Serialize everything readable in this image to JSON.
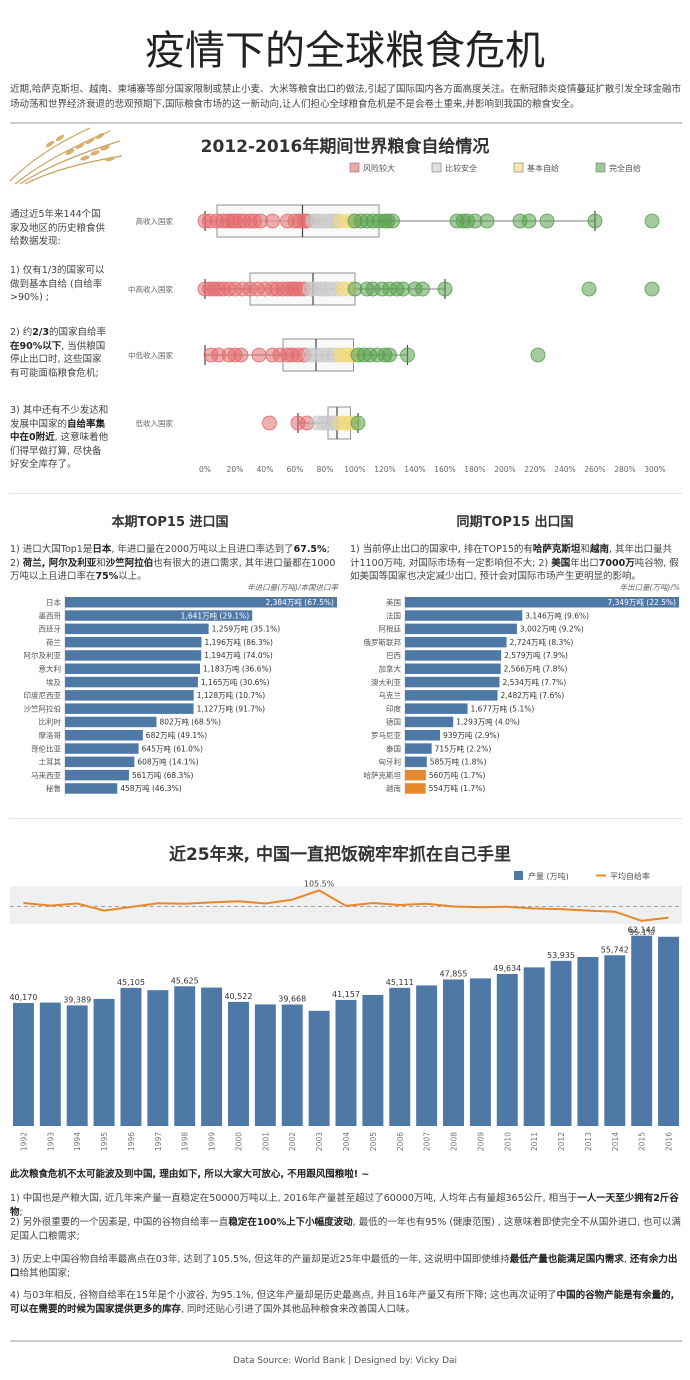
{
  "title": "疫情下的全球粮食危机",
  "intro": "近期,哈萨克斯坦、越南、柬埔寨等部分国家限制或禁止小麦、大米等粮食出口的做法,引起了国际国内各方面高度关注。在新冠肺炎疫情蔓延扩散引发全球金融市场动荡和世界经济衰退的悲观预期下,国际粮食市场的这一新动向,让人们担心全球粮食危机是不是会卷土重来,并影响到我国的粮食安全。",
  "colors": {
    "blue": "#4e79a7",
    "orange": "#e8872b",
    "red": "#e36b6d",
    "gray": "#c9c9c9",
    "yellow": "#f1d97a",
    "green": "#59a14f"
  },
  "self_sufficiency": {
    "title": "2012-2016年期间世界粮食自给情况",
    "legend": [
      "风险较大",
      "比较安全",
      "基本自给",
      "完全自给"
    ],
    "side_intro": "通过近5年来144个国家及地区的历史粮食供给数据发现:",
    "side_p1": "1) 仅有1/3的国家可以做到基本自给 (自给率>90%) ;",
    "side_p2_a": "2) 约",
    "side_p2_b": "2/3",
    "side_p2_c": "的国家自给率",
    "side_p2_d": "在90%以下",
    "side_p2_e": ", 当供粮国停止出口时, 这些国家有可能面临粮食危机;",
    "side_p3_a": "3) 其中还有不少发达和发展中国家的",
    "side_p3_b": "自给率集中在0附近",
    "side_p3_c": ", 这意味着他们得早做打算, 尽快备好安全库存了。",
    "axis_ticks": [
      "0%",
      "20%",
      "40%",
      "60%",
      "80%",
      "100%",
      "120%",
      "140%",
      "160%",
      "180%",
      "200%",
      "220%",
      "240%",
      "260%",
      "280%",
      "300%"
    ],
    "chart_data": {
      "type": "scatter",
      "x_unit": "%",
      "xlim": [
        0,
        300
      ],
      "groups": [
        {
          "name": "高收入国家",
          "box": [
            8,
            65,
            116
          ],
          "whisker": [
            0,
            260
          ],
          "points": [
            0,
            3,
            8,
            12,
            15,
            18,
            20,
            23,
            26,
            30,
            33,
            37,
            45,
            55,
            60,
            63,
            66,
            68,
            72,
            75,
            78,
            82,
            85,
            88,
            90,
            95,
            98,
            100,
            104,
            108,
            112,
            116,
            120,
            122,
            125,
            168,
            172,
            175,
            180,
            188,
            210,
            216,
            228,
            260,
            298
          ]
        },
        {
          "name": "中高收入国家",
          "box": [
            30,
            72,
            100
          ],
          "whisker": [
            0,
            160
          ],
          "points": [
            0,
            3,
            6,
            9,
            12,
            16,
            20,
            25,
            30,
            35,
            40,
            45,
            48,
            52,
            55,
            58,
            60,
            63,
            66,
            70,
            73,
            77,
            80,
            84,
            88,
            92,
            96,
            100,
            108,
            112,
            118,
            123,
            128,
            132,
            140,
            145,
            160,
            256,
            298
          ]
        },
        {
          "name": "中低收入国家",
          "box": [
            52,
            74,
            99
          ],
          "whisker": [
            0,
            135
          ],
          "points": [
            4,
            9,
            16,
            20,
            24,
            36,
            45,
            50,
            55,
            58,
            62,
            66,
            70,
            74,
            78,
            82,
            86,
            90,
            93,
            96,
            99,
            102,
            106,
            110,
            115,
            120,
            123,
            135,
            222
          ]
        },
        {
          "name": "低收入国家",
          "box": [
            82,
            88,
            97
          ],
          "whisker": [
            62,
            102
          ],
          "points": [
            43,
            62,
            68,
            75,
            79,
            82,
            85,
            87,
            90,
            93,
            96,
            99,
            102
          ]
        }
      ]
    }
  },
  "imports": {
    "title": "本期TOP15 进口国",
    "note_1": "1) 进口大国Top1是",
    "note_2": "日本",
    "note_3": ", 年进口量在2000万吨以上且进口率达到了",
    "note_4": "67.5%",
    "note_5": "; 2) ",
    "note_6": "荷兰, 阿尔及利亚",
    "note_7": "和",
    "note_8": "沙竺阿拉伯",
    "note_9": "也有很大的进口需求, 其年进口量都在1000万吨以上且进口率在",
    "note_10": "75%",
    "note_11": "以上。",
    "axis_label": "年进口量(万吨)/本国进口率",
    "chart_data": {
      "type": "bar",
      "categories": [
        "日本",
        "墨西哥",
        "西班牙",
        "荷兰",
        "阿尔及利亚",
        "意大利",
        "埃及",
        "印度尼西亚",
        "沙竺阿拉伯",
        "比利时",
        "摩洛哥",
        "哥伦比亚",
        "土耳其",
        "马来西亚",
        "秘鲁"
      ],
      "values": [
        2384,
        1641,
        1259,
        1196,
        1194,
        1183,
        1165,
        1128,
        1127,
        802,
        682,
        645,
        608,
        561,
        458
      ],
      "labels": [
        "2,384万吨 (67.5%)",
        "1,641万吨 (29.1%)",
        "1,259万吨 (35.1%)",
        "1,196万吨 (86.3%)",
        "1,194万吨 (74.0%)",
        "1,183万吨 (36.6%)",
        "1,165万吨 (30.6%)",
        "1,128万吨 (10.7%)",
        "1,127万吨 (91.7%)",
        "802万吨 (68.5%)",
        "682万吨 (49.1%)",
        "645万吨 (61.0%)",
        "608万吨 (14.1%)",
        "561万吨 (68.3%)",
        "458万吨 (46.3%)"
      ]
    }
  },
  "exports": {
    "title": "同期TOP15 出口国",
    "note_1": "1) 当前停止出口的国家中, 排在TOP15的有",
    "note_2": "哈萨克斯坦",
    "note_3": "和",
    "note_4": "越南",
    "note_5": ", 其年出口量共计1100万吨, 对国际市场有一定影响但不大; 2) ",
    "note_6": "美国",
    "note_7": "年出口",
    "note_8": "7000万",
    "note_9": "吨谷物, 假如美国等国家也决定减少出口, 预计会对国际市场产生更明显的影响。",
    "axis_label": "年出口量(万吨)/%",
    "chart_data": {
      "type": "bar",
      "categories": [
        "美国",
        "法国",
        "阿根廷",
        "俄罗斯联邦",
        "巴西",
        "加拿大",
        "澳大利亚",
        "乌克兰",
        "印度",
        "德国",
        "罗马尼亚",
        "泰国",
        "匈牙利",
        "哈萨克斯坦",
        "越南"
      ],
      "values": [
        7349,
        3146,
        3002,
        2724,
        2579,
        2566,
        2534,
        2482,
        1677,
        1293,
        939,
        715,
        585,
        560,
        554
      ],
      "labels": [
        "7,349万吨 (22.5%)",
        "3,146万吨 (9.6%)",
        "3,002万吨 (9.2%)",
        "2,724万吨 (8.3%)",
        "2,579万吨 (7.9%)",
        "2,566万吨 (7.8%)",
        "2,534万吨 (7.7%)",
        "2,482万吨 (7.6%)",
        "1,677万吨 (5.1%)",
        "1,293万吨 (4.0%)",
        "939万吨 (2.9%)",
        "715万吨 (2.2%)",
        "585万吨 (1.8%)",
        "560万吨 (1.7%)",
        "554万吨 (1.7%)"
      ],
      "highlight": [
        "哈萨克斯坦",
        "越南"
      ]
    }
  },
  "china": {
    "title": "近25年来, 中国一直把饭碗牢牢抓在自己手里",
    "legend_bar": "产量 (万吨)",
    "legend_line": "平均自给率",
    "peak_label": "105.5%",
    "low_label": "95.1%",
    "chart_data": {
      "type": "bar",
      "categories": [
        "1992",
        "1993",
        "1994",
        "1995",
        "1996",
        "1997",
        "1998",
        "1999",
        "2000",
        "2001",
        "2002",
        "2003",
        "2004",
        "2005",
        "2006",
        "2007",
        "2008",
        "2009",
        "2010",
        "2011",
        "2012",
        "2013",
        "2014",
        "2015",
        "2016"
      ],
      "series": [
        {
          "name": "产量 (万吨)",
          "values": [
            40170,
            40300,
            39389,
            41500,
            45105,
            44350,
            45625,
            45200,
            40522,
            39700,
            39668,
            37600,
            41157,
            42800,
            45111,
            45900,
            47855,
            48200,
            49634,
            51800,
            53935,
            55200,
            55742,
            62144,
            61800
          ]
        },
        {
          "name": "平均自给率",
          "values": [
            101.2,
            100.3,
            101.0,
            98.6,
            99.8,
            101.1,
            100.9,
            101.4,
            101.8,
            101.0,
            102.3,
            105.5,
            100.2,
            101.2,
            100.5,
            100.9,
            100.0,
            99.7,
            99.9,
            99.3,
            99.1,
            98.6,
            98.2,
            95.1,
            96.2
          ]
        }
      ],
      "shown_value_labels": {
        "1992": "40,170",
        "1994": "39,389",
        "1996": "45,105",
        "1998": "45,625",
        "2000": "40,522",
        "2002": "39,668",
        "2004": "41,157",
        "2006": "45,111",
        "2008": "47,855",
        "2010": "49,634",
        "2012": "53,935",
        "2014": "55,742",
        "2015": "62,144"
      }
    },
    "conclusion_head": "此次粮食危机不太可能波及到中国, 理由如下, 所以大家大可放心, 不用跟风囤粮啦! ~",
    "c1_a": "1) 中国也是产粮大国, 近几年来产量一直稳定在50000万吨以上, 2016年产量甚至超过了60000万吨, 人均年占有量超365公斤, 相当于",
    "c1_b": "一人一天至少拥有2斤谷物",
    "c1_c": ";",
    "c2_a": "2) 另外很重要的一个因素是, 中国的谷物自给率一直",
    "c2_b": "稳定在100%上下小幅度波动",
    "c2_c": ", 最低的一年也有95% (健康范围) , 这意味着即使完全不从国外进口, 也可以满足国人口粮需求;",
    "c3_a": "3) 历史上中国谷物自给率最高点在03年, 达到了105.5%, 但这年的产量却是近25年中最低的一年, 这说明中国即使维持",
    "c3_b": "最低产量也能满足国内需求",
    "c3_c": ", ",
    "c3_d": "还有余力出口",
    "c3_e": "给其他国家;",
    "c4_a": "4) 与03年相反, 谷物自给率在15年是个小波谷, 为95.1%, 但这年产量却是历史最高点, 并且16年产量又有所下降; 这也再次证明了",
    "c4_b": "中国的谷物产能是有余量的, 可以在需要的时候为国家提供更多的库存",
    "c4_c": ", 同时还贴心引进了国外其他品种粮食来改善国人口味。"
  },
  "footer": "Data Source: World Bank | Designed by: Vicky Dai"
}
